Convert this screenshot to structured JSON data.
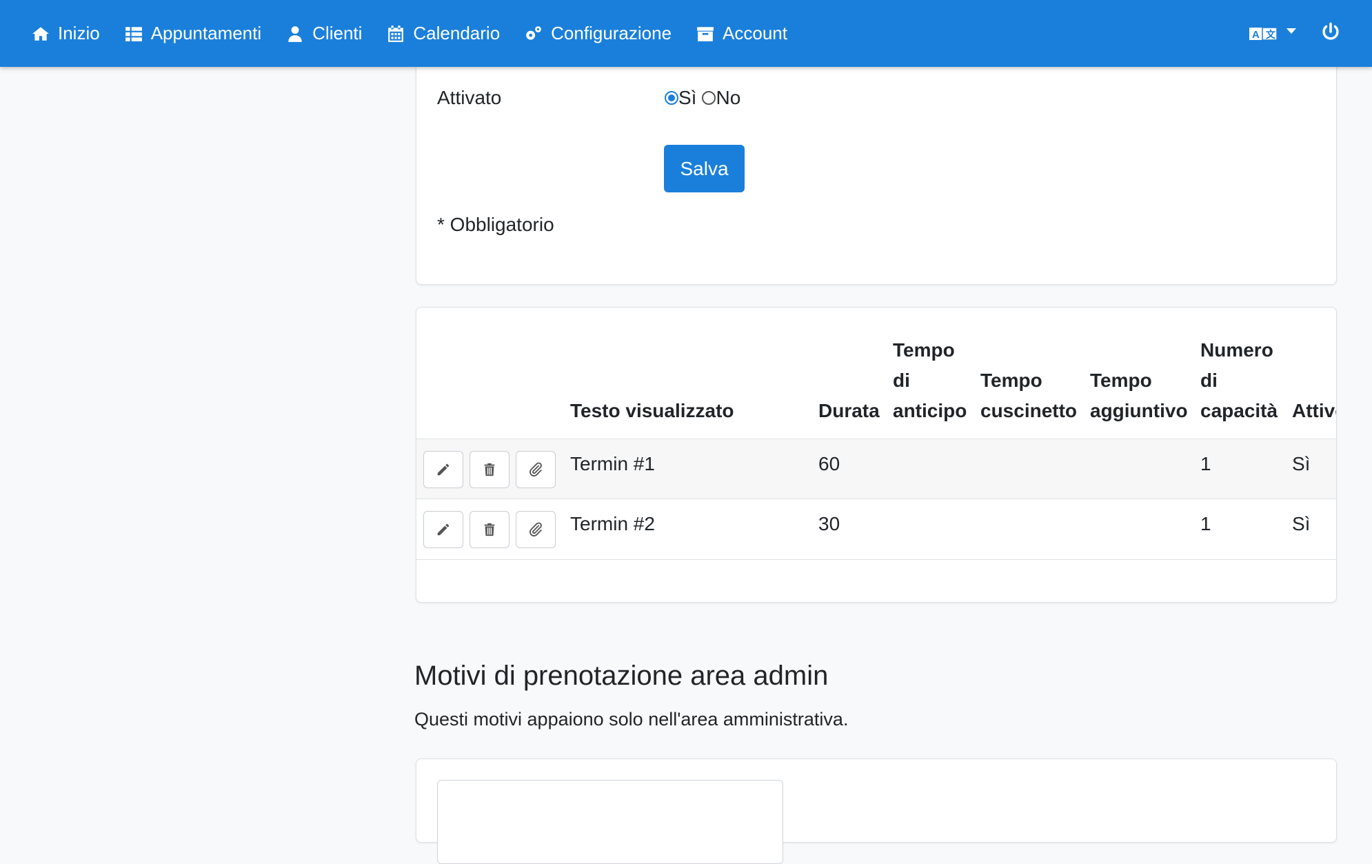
{
  "nav": {
    "items": [
      {
        "label": "Inizio",
        "icon": "home-icon"
      },
      {
        "label": "Appuntamenti",
        "icon": "list-icon"
      },
      {
        "label": "Clienti",
        "icon": "user-icon"
      },
      {
        "label": "Calendario",
        "icon": "calendar-icon"
      },
      {
        "label": "Configurazione",
        "icon": "gears-icon"
      },
      {
        "label": "Account",
        "icon": "archive-icon"
      }
    ],
    "language_icon": "language-icon",
    "logout_icon": "power-icon"
  },
  "form": {
    "activated_label": "Attivato",
    "radio_yes": "Sì",
    "radio_no": "No",
    "selected": "Sì",
    "save_label": "Salva",
    "required_note": "* Obbligatorio"
  },
  "table": {
    "headers": [
      {
        "key": "text",
        "label": "Testo visualizzato"
      },
      {
        "key": "duration",
        "label": "Durata"
      },
      {
        "key": "advance",
        "label": "Tempo di anticipo"
      },
      {
        "key": "buffer",
        "label": "Tempo cuscinetto"
      },
      {
        "key": "extra",
        "label": "Tempo aggiuntivo"
      },
      {
        "key": "capacity",
        "label": "Numero di capacità"
      },
      {
        "key": "active",
        "label": "Attivo"
      }
    ],
    "rows": [
      {
        "text": "Termin #1",
        "duration": "60",
        "advance": "",
        "buffer": "",
        "extra": "",
        "capacity": "1",
        "active": "Sì"
      },
      {
        "text": "Termin #2",
        "duration": "30",
        "advance": "",
        "buffer": "",
        "extra": "",
        "capacity": "1",
        "active": "Sì"
      }
    ],
    "actions": [
      "edit-icon",
      "delete-icon",
      "attach-icon"
    ]
  },
  "admin_section": {
    "title": "Motivi di prenotazione area admin",
    "description": "Questi motivi appaiono solo nell'area amministrativa."
  },
  "colors": {
    "primary": "#1a7fdb",
    "background": "#f8f9fa"
  }
}
